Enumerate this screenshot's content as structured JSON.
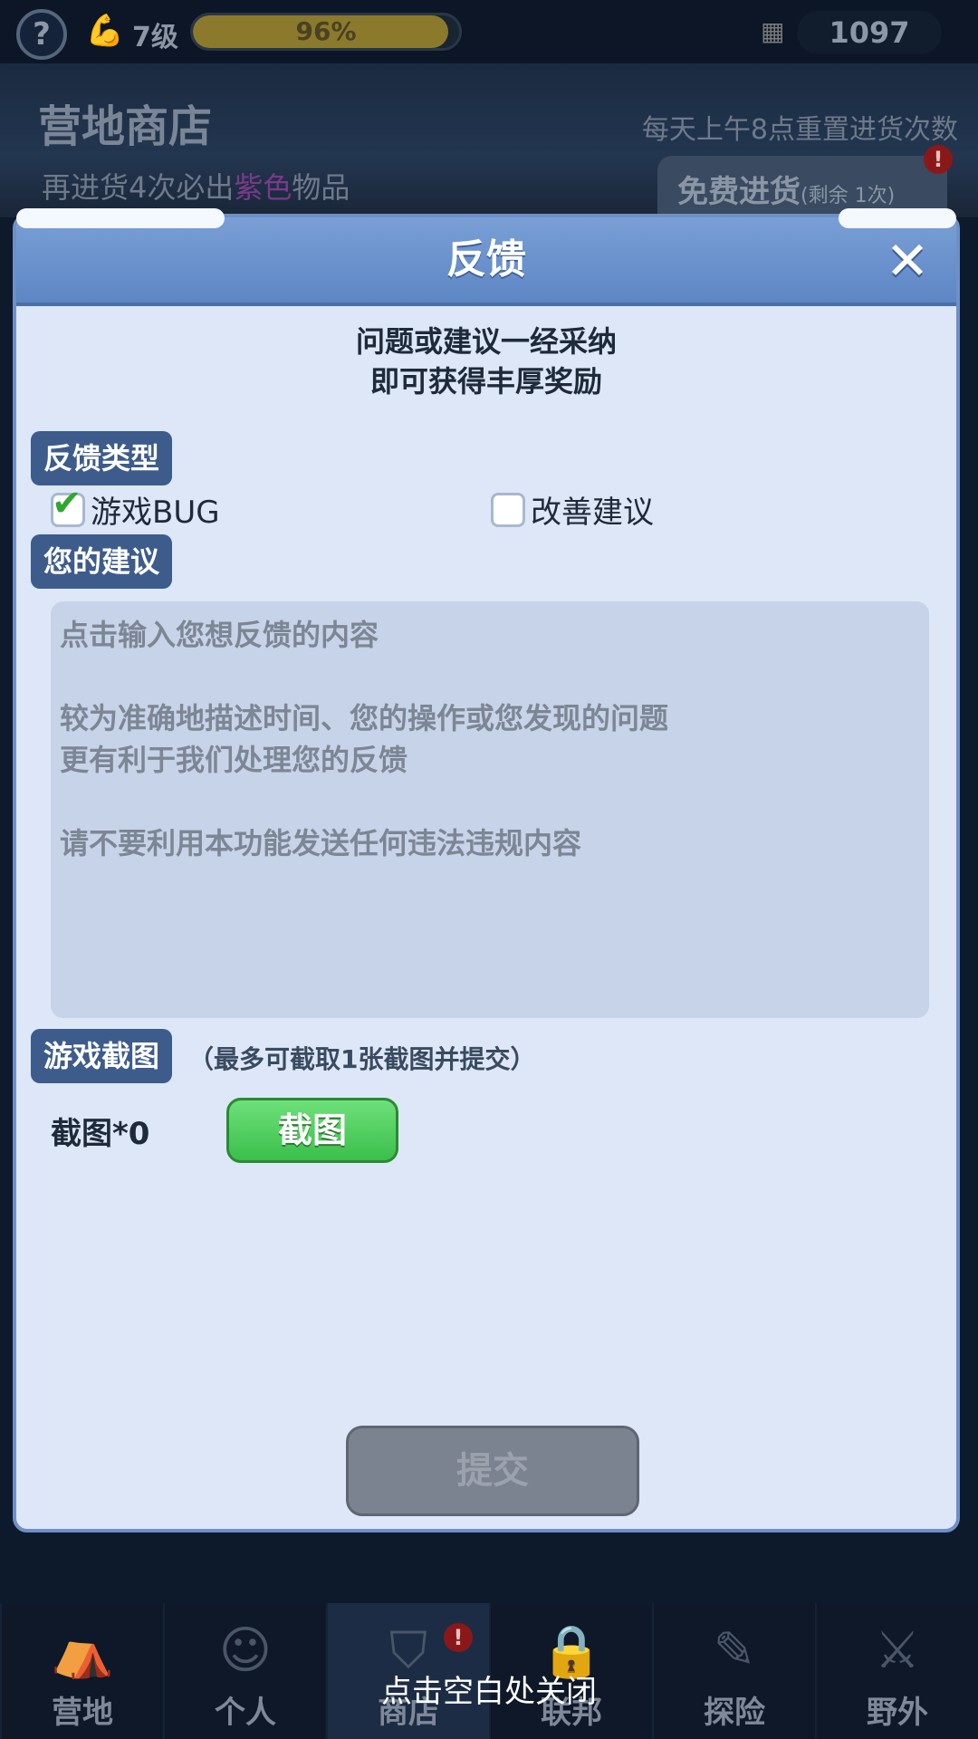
{
  "topbar": {
    "help_icon": "question-icon",
    "level": "7级",
    "exp_percent_text": "96%",
    "exp_progress": 0.96,
    "resource_icon": "supply-icon",
    "resource_value": "1097"
  },
  "shop": {
    "title": "营地商店",
    "subtitle_prefix": "再进货4次必出",
    "subtitle_highlight": "紫色",
    "subtitle_suffix": "物品",
    "reset_note": "每天上午8点重置进货次数",
    "free_restock_label": "免费进货",
    "free_restock_remaining": "(剩余 1次)",
    "alert": "!"
  },
  "dialog": {
    "title": "反馈",
    "close_icon": "close-icon",
    "reward_line1": "问题或建议一经采纳",
    "reward_line2": "即可获得丰厚奖励",
    "type_section": "反馈类型",
    "option_bug": "游戏BUG",
    "option_bug_checked": true,
    "option_suggest": "改善建议",
    "option_suggest_checked": false,
    "suggest_section": "您的建议",
    "textarea_placeholder": "点击输入您想反馈的内容\n\n较为准确地描述时间、您的操作或您发现的问题\n更有利于我们处理您的反馈\n\n请不要利用本功能发送任何违法违规内容",
    "screenshot_section": "游戏截图",
    "screenshot_hint": "（最多可截取1张截图并提交）",
    "screenshot_count": "截图*0",
    "screenshot_button": "截图",
    "submit_button": "提交"
  },
  "bottom_nav": {
    "items": [
      {
        "label": "营地",
        "icon": "tent-icon"
      },
      {
        "label": "个人",
        "icon": "person-icon"
      },
      {
        "label": "商店",
        "icon": "shop-bag-icon",
        "alert": "!"
      },
      {
        "label": "联邦",
        "icon": "lock-icon"
      },
      {
        "label": "探险",
        "icon": "explore-icon"
      },
      {
        "label": "野外",
        "icon": "sword-map-icon"
      }
    ]
  },
  "close_hint": "点击空白处关闭",
  "colors": {
    "dialog_bg": "#dde7f8",
    "header_blue": "#5d86c4",
    "tag_blue": "#3d5c8c",
    "green_button": "#3bbf4a",
    "disabled_gray": "#7b8391"
  }
}
